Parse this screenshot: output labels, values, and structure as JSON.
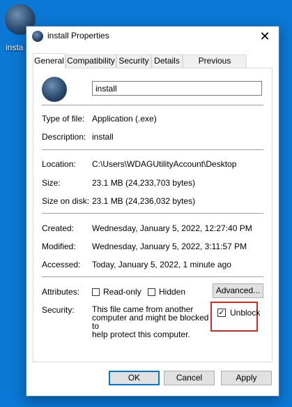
{
  "desktop": {
    "icon_label": "insta"
  },
  "dialog": {
    "title": "install Properties",
    "close_glyph": "✕",
    "tabs": [
      {
        "label": "General"
      },
      {
        "label": "Compatibility"
      },
      {
        "label": "Security"
      },
      {
        "label": "Details"
      },
      {
        "label": "Previous Versions"
      }
    ],
    "file_name": "install",
    "fields": {
      "type_label": "Type of file:",
      "type_value": "Application (.exe)",
      "description_label": "Description:",
      "description_value": "install",
      "location_label": "Location:",
      "location_value": "C:\\Users\\WDAGUtilityAccount\\Desktop",
      "size_label": "Size:",
      "size_value": "23.1 MB (24,233,703 bytes)",
      "size_on_disk_label": "Size on disk:",
      "size_on_disk_value": "23.1 MB (24,236,032 bytes)",
      "created_label": "Created:",
      "created_value": "Wednesday, January 5, 2022, 12:27:40 PM",
      "modified_label": "Modified:",
      "modified_value": "Wednesday, January 5, 2022, 3:11:57 PM",
      "accessed_label": "Accessed:",
      "accessed_value": "Today, January 5, 2022, 1 minute ago",
      "attributes_label": "Attributes:",
      "readonly_label": "Read-only",
      "hidden_label": "Hidden",
      "advanced_label": "Advanced...",
      "security_label": "Security:",
      "security_text_1": "This file came from another",
      "security_text_2": "computer and might be blocked to",
      "security_text_3": "help protect this computer.",
      "unblock_label": "Unblock",
      "unblock_checked": true
    },
    "buttons": {
      "ok": "OK",
      "cancel": "Cancel",
      "apply": "Apply"
    },
    "colors": {
      "desktop": "#0a78d4",
      "highlight": "#e5251a",
      "default_button_border": "#0078d7"
    }
  }
}
